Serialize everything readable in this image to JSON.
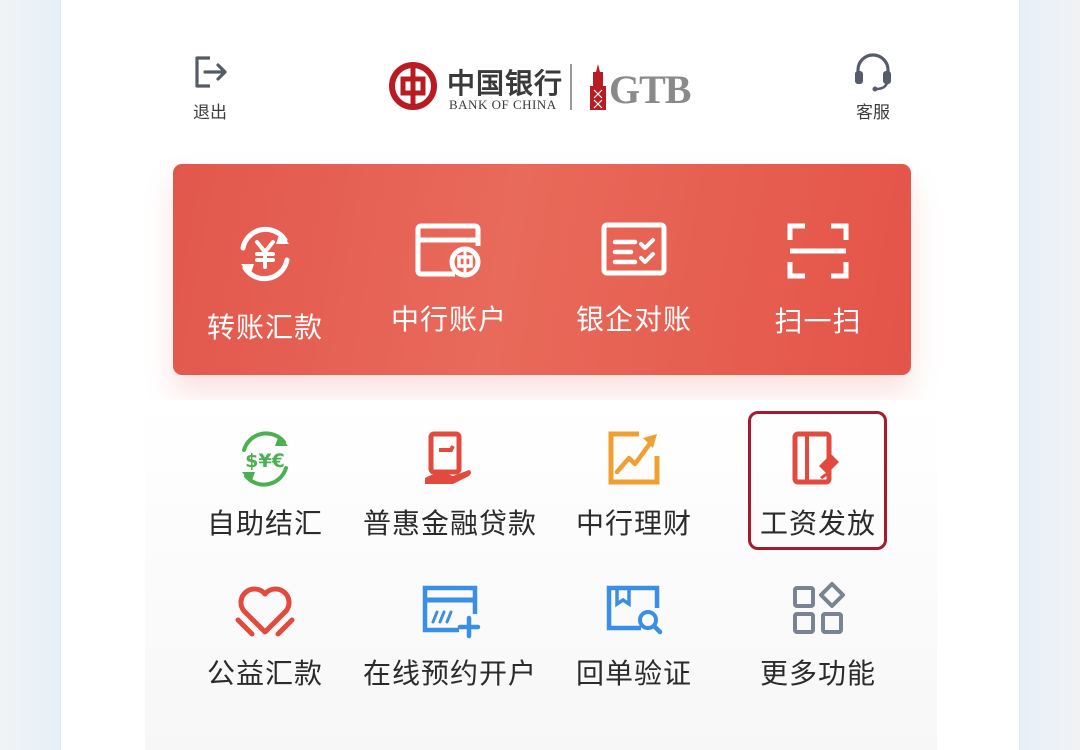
{
  "header": {
    "logout_label": "退出",
    "service_label": "客服",
    "logo": {
      "bank_cn": "中国银行",
      "bank_en": "BANK OF CHINA",
      "gtb": "GTB"
    }
  },
  "quick_actions": [
    {
      "label": "转账汇款",
      "icon": "yuan-transfer-icon"
    },
    {
      "label": "中行账户",
      "icon": "account-card-icon"
    },
    {
      "label": "银企对账",
      "icon": "reconcile-icon"
    },
    {
      "label": "扫一扫",
      "icon": "scan-icon"
    }
  ],
  "services": [
    {
      "label": "自助结汇",
      "icon": "currency-exchange-icon",
      "color": "#4caf50"
    },
    {
      "label": "普惠金融贷款",
      "icon": "loan-document-icon",
      "color": "#e24a3e"
    },
    {
      "label": "中行理财",
      "icon": "wealth-chart-icon",
      "color": "#f0a030"
    },
    {
      "label": "工资发放",
      "icon": "payroll-icon",
      "color": "#e24a3e",
      "highlighted": true
    },
    {
      "label": "公益汇款",
      "icon": "charity-heart-icon",
      "color": "#e24a3e"
    },
    {
      "label": "在线预约开户",
      "icon": "online-account-icon",
      "color": "#3a8ee6"
    },
    {
      "label": "回单验证",
      "icon": "receipt-verify-icon",
      "color": "#3a8ee6"
    },
    {
      "label": "更多功能",
      "icon": "more-apps-icon",
      "color": "#7a8392"
    }
  ],
  "colors": {
    "card_red": "#e2574c",
    "highlight_border": "#a8192e",
    "boc_red": "#b81c22"
  }
}
